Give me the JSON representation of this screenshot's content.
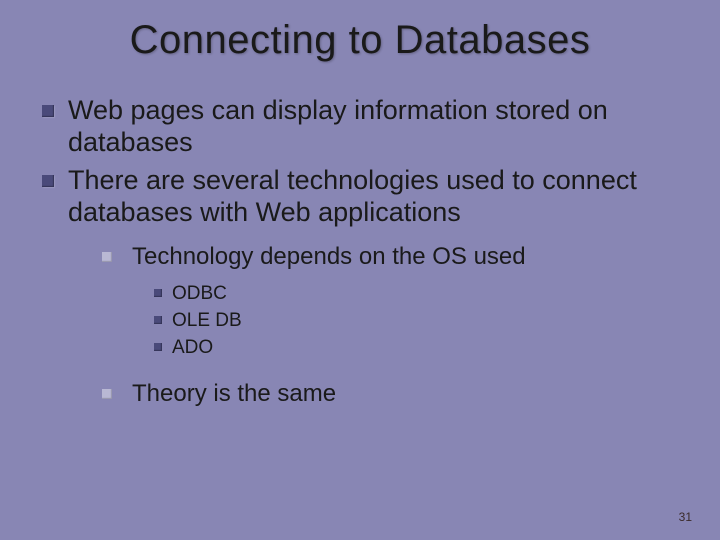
{
  "title": "Connecting to Databases",
  "bullets": {
    "l1_a": "Web pages can display information stored on databases",
    "l1_b": "There are several technologies used to connect databases with Web applications",
    "l2_a": "Technology depends on the OS used",
    "l3_a": "ODBC",
    "l3_b": "OLE DB",
    "l3_c": "ADO",
    "l2_b": "Theory is the same"
  },
  "page_number": "31"
}
